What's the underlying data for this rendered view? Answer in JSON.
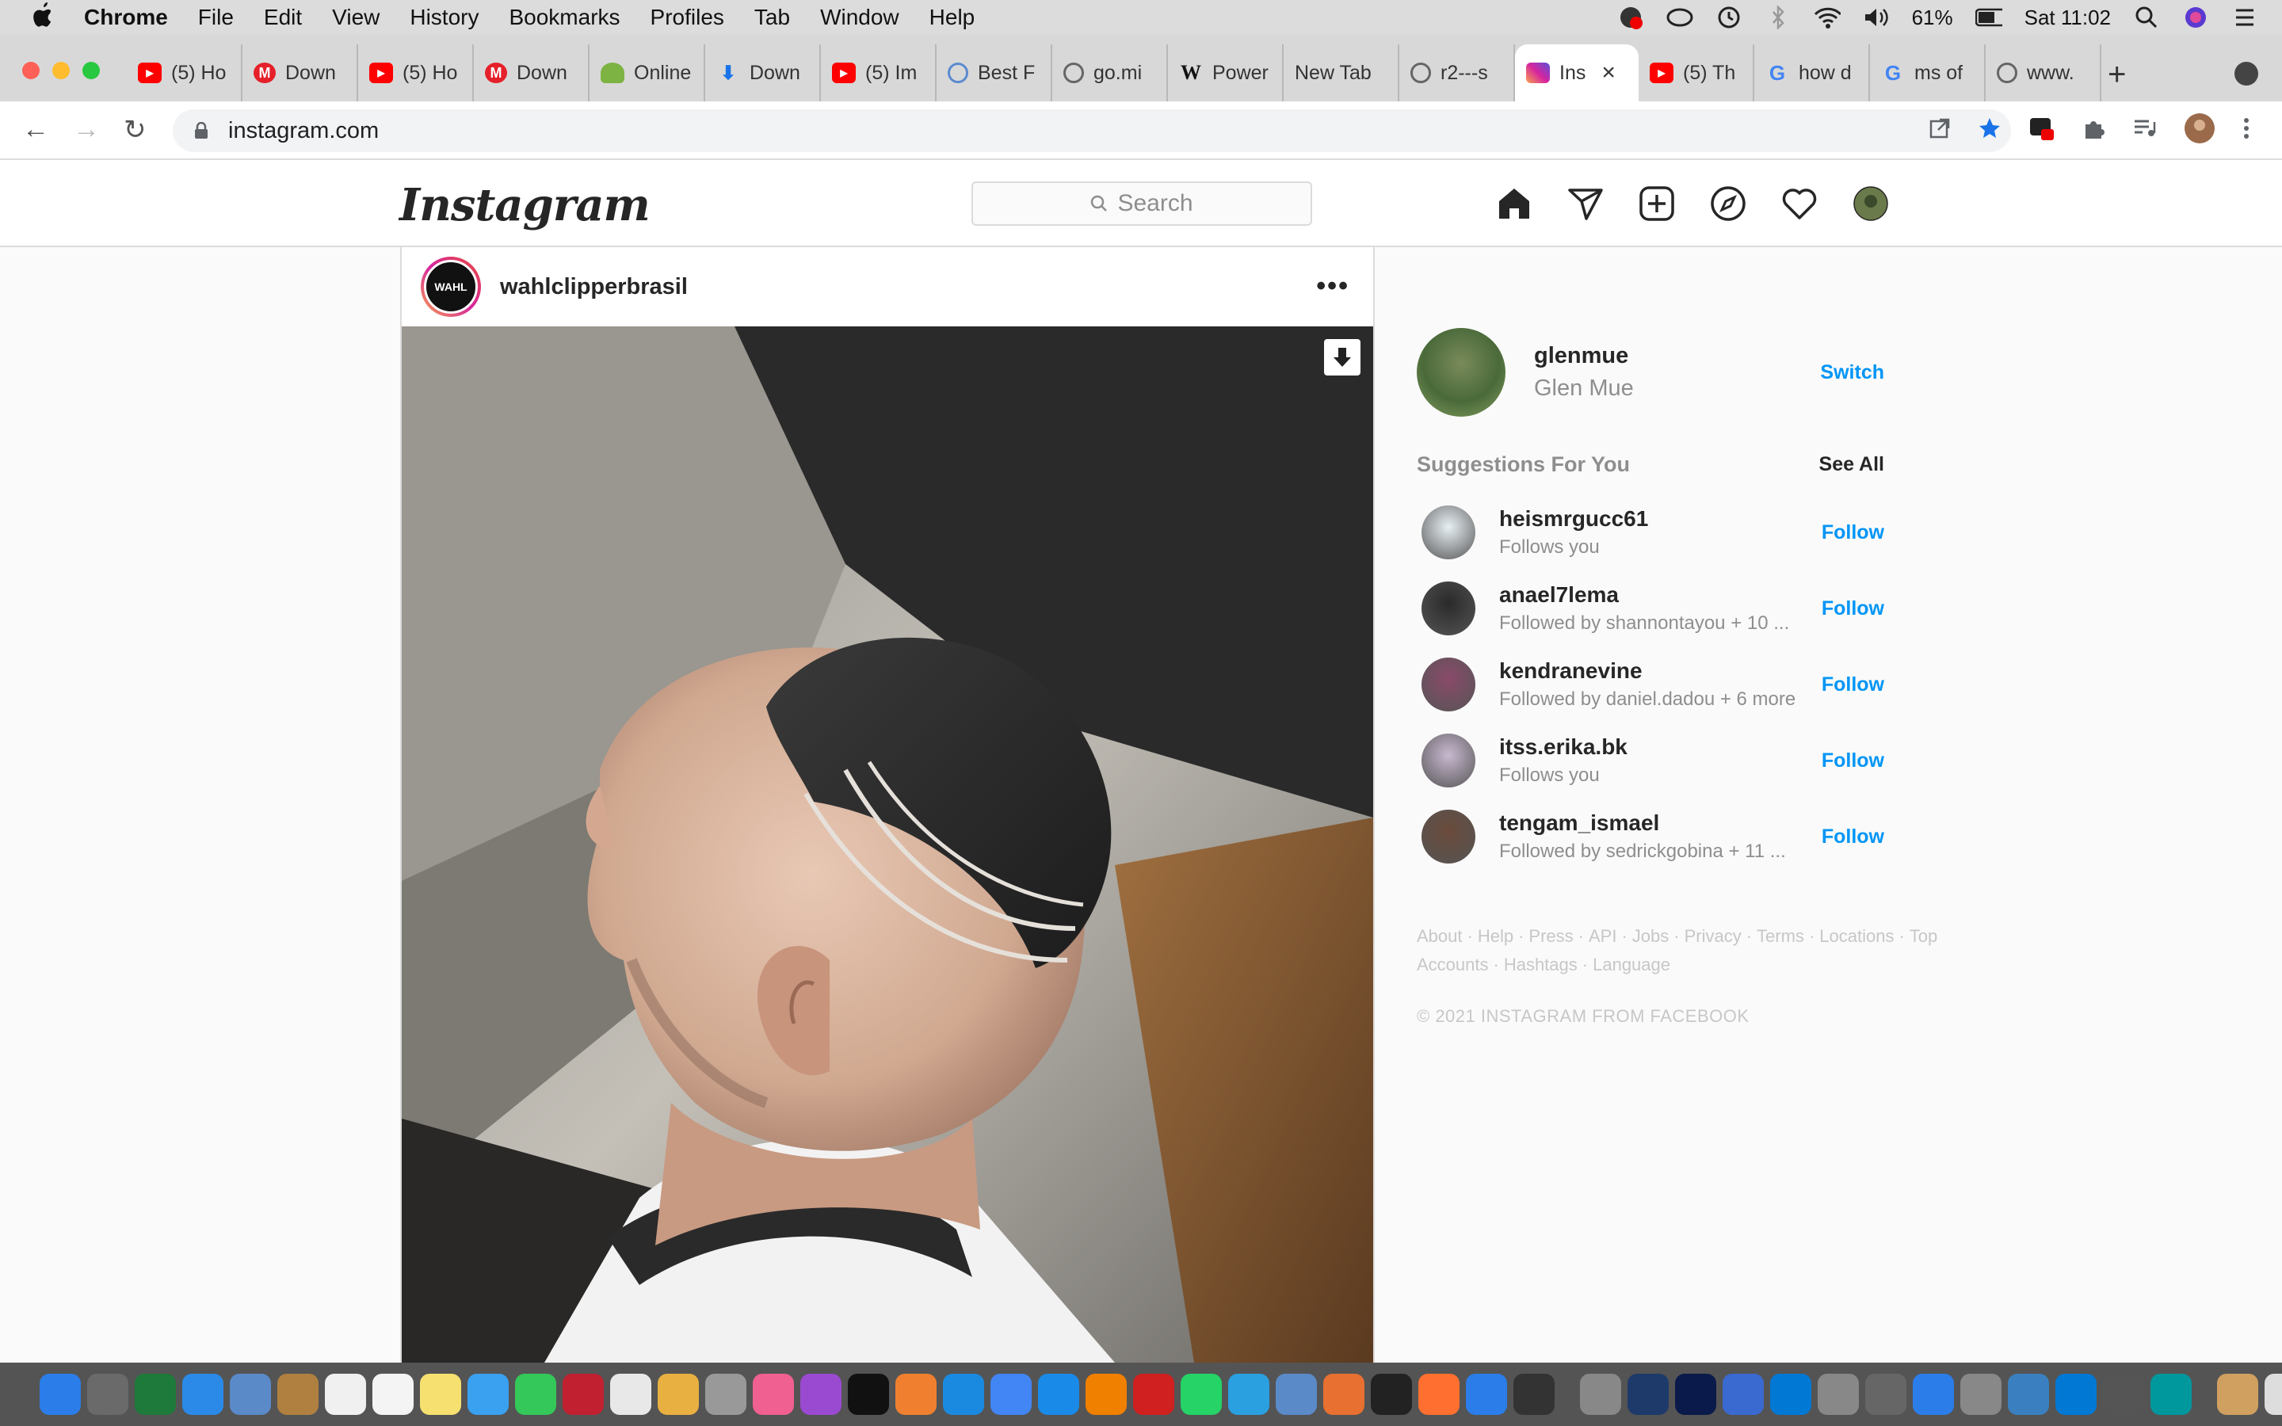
{
  "menubar": {
    "app": "Chrome",
    "items": [
      "File",
      "Edit",
      "View",
      "History",
      "Bookmarks",
      "Profiles",
      "Tab",
      "Window",
      "Help"
    ],
    "battery": "61%",
    "clock": "Sat 11:02"
  },
  "tabs": [
    {
      "label": "(5) Ho",
      "icon": "youtube-icon",
      "color": "#ff0000"
    },
    {
      "label": "Down",
      "icon": "m-icon",
      "color": "#e5202a"
    },
    {
      "label": "(5) Ho",
      "icon": "youtube-icon",
      "color": "#ff0000"
    },
    {
      "label": "Down",
      "icon": "m-icon",
      "color": "#e5202a"
    },
    {
      "label": "Online",
      "icon": "android-icon",
      "color": "#7cb342"
    },
    {
      "label": "Down",
      "icon": "download-icon",
      "color": "#1a73e8"
    },
    {
      "label": "(5) Im",
      "icon": "youtube-icon",
      "color": "#ff0000"
    },
    {
      "label": "Best F",
      "icon": "globe-icon",
      "color": "#5b8bd0"
    },
    {
      "label": "go.mi",
      "icon": "globe-icon",
      "color": "#666666"
    },
    {
      "label": "Power",
      "icon": "wikipedia-icon",
      "color": "#ffffff"
    },
    {
      "label": "New Tab",
      "icon": "",
      "color": ""
    },
    {
      "label": "r2---s",
      "icon": "globe-icon",
      "color": "#666666"
    },
    {
      "label": "Ins",
      "icon": "instagram-icon",
      "color": "#d6249f",
      "active": true
    },
    {
      "label": "(5) Th",
      "icon": "youtube-icon",
      "color": "#ff0000"
    },
    {
      "label": "how d",
      "icon": "google-icon",
      "color": "#4285f4"
    },
    {
      "label": "ms of",
      "icon": "google-icon",
      "color": "#4285f4"
    },
    {
      "label": "www.",
      "icon": "globe-icon",
      "color": "#666666"
    }
  ],
  "address": {
    "url": "instagram.com"
  },
  "instagram": {
    "logo": "Instagram",
    "search_placeholder": "Search"
  },
  "post": {
    "username": "wahlclipperbrasil",
    "avatar_text": "WAHL",
    "more": "•••"
  },
  "profile": {
    "username": "glenmue",
    "full_name": "Glen Mue",
    "switch": "Switch"
  },
  "suggestions": {
    "title": "Suggestions For You",
    "see_all": "See All",
    "follow_label": "Follow",
    "items": [
      {
        "name": "heismrgucc61",
        "sub": "Follows you",
        "color": "#e8f0f4"
      },
      {
        "name": "anael7lema",
        "sub": "Followed by shannontayou + 10 ...",
        "color": "#2a2a2a"
      },
      {
        "name": "kendranevine",
        "sub": "Followed by daniel.dadou + 6 more",
        "color": "#8a4a6a"
      },
      {
        "name": "itss.erika.bk",
        "sub": "Follows you",
        "color": "#c8b8d0"
      },
      {
        "name": "tengam_ismael",
        "sub": "Followed by sedrickgobina + 11 ...",
        "color": "#6a4a3a"
      }
    ]
  },
  "footer": {
    "links": [
      "About",
      "Help",
      "Press",
      "API",
      "Jobs",
      "Privacy",
      "Terms",
      "Locations",
      "Top Accounts",
      "Hashtags",
      "Language"
    ],
    "copyright": "© 2021 INSTAGRAM FROM FACEBOOK"
  }
}
